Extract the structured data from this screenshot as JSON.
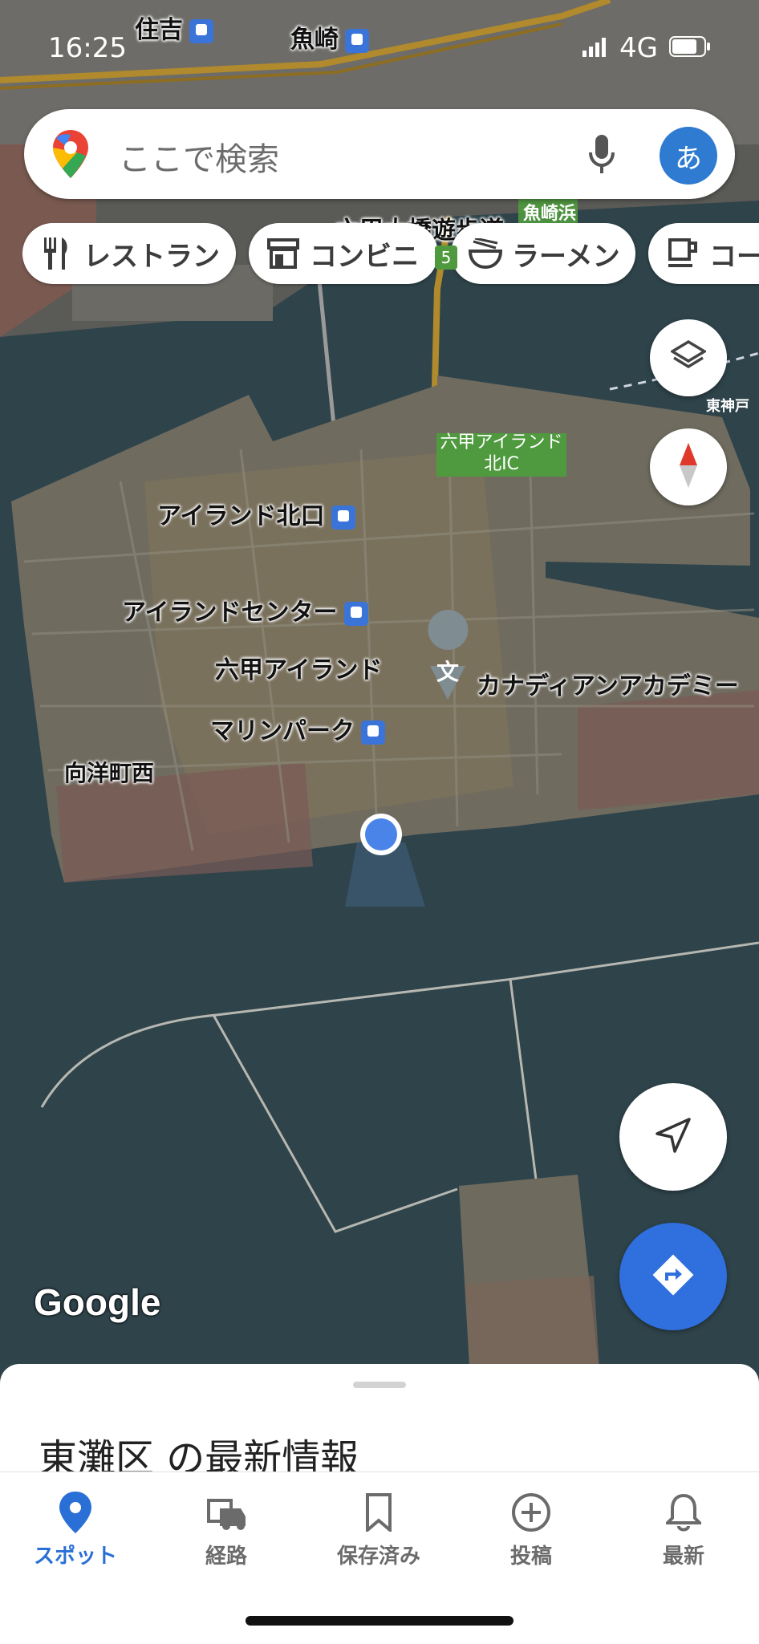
{
  "status_bar": {
    "time": "16:25",
    "network": "4G"
  },
  "search": {
    "placeholder": "ここで検索",
    "avatar_initial": "あ"
  },
  "chips": [
    {
      "label": "レストラン",
      "icon": "fork-knife-icon"
    },
    {
      "label": "コンビニ",
      "icon": "store-icon"
    },
    {
      "label": "ラーメン",
      "icon": "ramen-bowl-icon"
    },
    {
      "label": "コー",
      "icon": "coffee-cup-icon"
    }
  ],
  "map_labels": {
    "sumiyoshi": "住吉",
    "uozaki": "魚崎",
    "uozakihama": "魚崎浜",
    "rokko_bridge": "六甲大橋遊歩道",
    "higashikobe": "東神戸",
    "rokko_ic": "六甲アイランド\n北IC",
    "island_kitaguchi": "アイランド北口",
    "island_center": "アイランドセンター",
    "rokko_island": "六甲アイランド",
    "canadian_academy": "カナディアンアカデミー",
    "school_glyph": "文",
    "marine_park": "マリンパーク",
    "koyocho_nishi": "向洋町西",
    "route_number": "5"
  },
  "attribution": "Google",
  "sheet": {
    "title": "東灘区 の最新情報"
  },
  "tabs": [
    {
      "label": "スポット",
      "icon": "location-pin-icon",
      "active": true
    },
    {
      "label": "経路",
      "icon": "car-icon",
      "active": false
    },
    {
      "label": "保存済み",
      "icon": "bookmark-icon",
      "active": false
    },
    {
      "label": "投稿",
      "icon": "add-circle-icon",
      "active": false
    },
    {
      "label": "最新",
      "icon": "bell-icon",
      "active": false
    }
  ],
  "colors": {
    "accent": "#2f6fde",
    "tab_active": "#2a6fd6",
    "water": "#2b3f47",
    "land": "#6f6a5f"
  }
}
